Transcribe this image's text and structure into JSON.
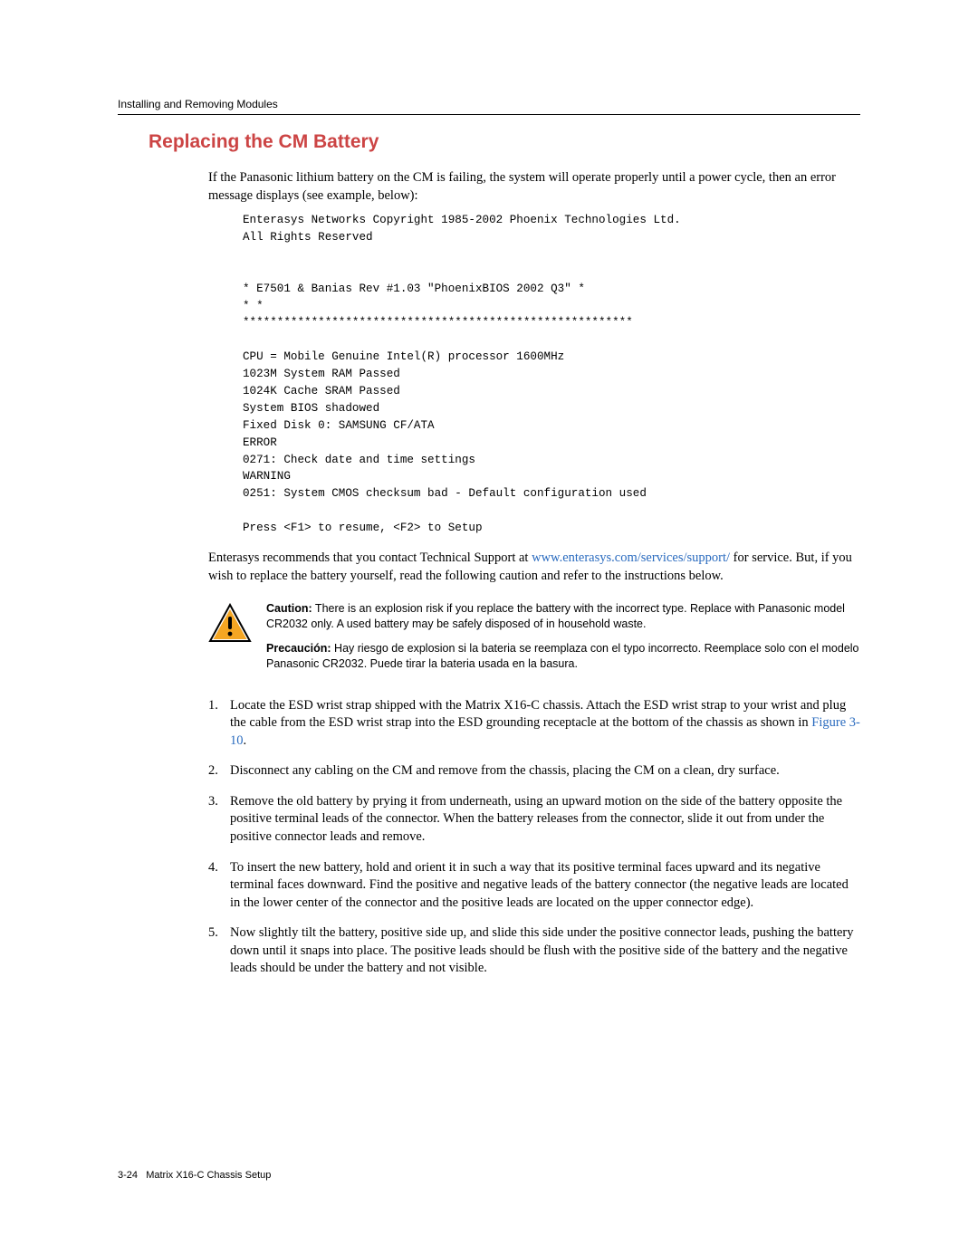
{
  "header": {
    "section": "Installing and Removing Modules"
  },
  "heading": "Replacing the CM Battery",
  "intro": "If the Panasonic lithium battery on the CM is failing, the system will operate properly until a power cycle, then an error message displays (see example, below):",
  "code": "Enterasys Networks Copyright 1985-2002 Phoenix Technologies Ltd.\nAll Rights Reserved\n\n\n* E7501 & Banias Rev #1.03 \"PhoenixBIOS 2002 Q3\" *\n* *\n*********************************************************\n\nCPU = Mobile Genuine Intel(R) processor 1600MHz\n1023M System RAM Passed\n1024K Cache SRAM Passed\nSystem BIOS shadowed\nFixed Disk 0: SAMSUNG CF/ATA\nERROR\n0271: Check date and time settings\nWARNING\n0251: System CMOS checksum bad - Default configuration used\n\nPress <F1> to resume, <F2> to Setup",
  "rec_pre": "Enterasys recommends that you contact Technical Support at ",
  "rec_link": "www.enterasys.com/services/support/",
  "rec_post": " for service. But, if you wish to replace the battery yourself, read the following caution and refer to the instructions below.",
  "caution": {
    "c_label": "Caution:",
    "c_text": " There is an explosion risk if you replace the battery with the incorrect type. Replace with Panasonic model CR2032 only. A used battery may be safely disposed of in household waste.",
    "p_label": "Precaución:",
    "p_text": " Hay riesgo de explosion si la bateria se reemplaza con el typo incorrecto. Reemplace solo con el modelo Panasonic CR2032. Puede tirar la bateria usada en la basura."
  },
  "steps": {
    "n1": "1.",
    "t1a": "Locate the ESD wrist strap shipped with the Matrix X16-C chassis. Attach the ESD wrist strap to your wrist and plug the cable from the ESD wrist strap into the ESD grounding receptacle at the bottom of the chassis as shown in ",
    "t1link": "Figure 3-10",
    "t1b": ".",
    "n2": "2.",
    "t2": "Disconnect any cabling on the CM and remove from the chassis, placing the CM on a clean, dry surface.",
    "n3": "3.",
    "t3": "Remove the old battery by prying it from underneath, using an upward motion on the side of the battery opposite the positive terminal leads of the connector. When the battery releases from the connector, slide it out from under the positive connector leads and remove.",
    "n4": "4.",
    "t4": "To insert the new battery, hold and orient it in such a way that its positive terminal faces upward and its negative terminal faces downward. Find the positive and negative leads of the battery connector (the negative leads are located in the lower center of the connector and the positive leads are located on the upper connector edge).",
    "n5": "5.",
    "t5": "Now slightly tilt the battery, positive side up, and slide this side under the positive connector leads, pushing the battery down until it snaps into place. The positive leads should be flush with the positive side of the battery and the negative leads should be under the battery and not visible."
  },
  "footer": {
    "page": "3-24",
    "title": "Matrix X16-C Chassis Setup"
  }
}
